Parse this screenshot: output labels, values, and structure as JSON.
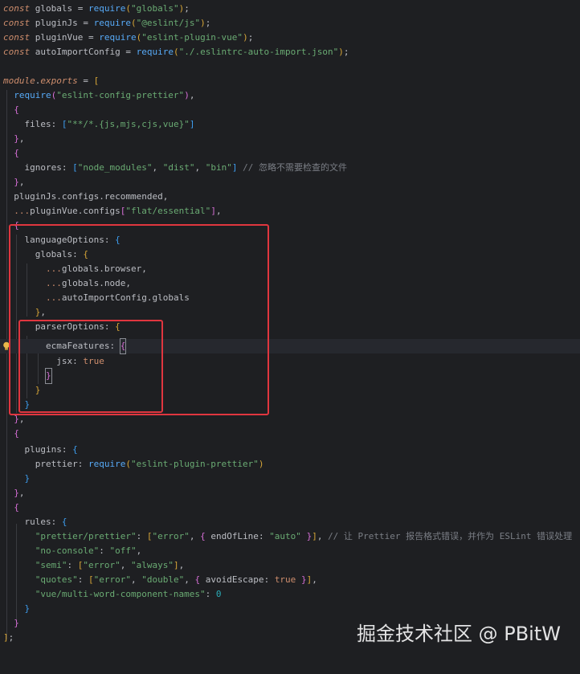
{
  "watermark": "掘金技术社区 @ PBitW",
  "tokens": {
    "const": "const",
    "globals": "globals",
    "pluginJs": "pluginJs",
    "pluginVue": "pluginVue",
    "autoImportConfig": "autoImportConfig",
    "require": "require",
    "s_globals": "\"globals\"",
    "s_eslint_js": "\"@eslint/js\"",
    "s_plugin_vue": "\"eslint-plugin-vue\"",
    "s_auto_import": "\"./.eslintrc-auto-import.json\"",
    "module": "module",
    "exports": "exports",
    "s_config_prettier": "\"eslint-config-prettier\"",
    "files": "files",
    "s_files_glob": "\"**/*.{js,mjs,cjs,vue}\"",
    "ignores": "ignores",
    "s_node_modules": "\"node_modules\"",
    "s_dist": "\"dist\"",
    "s_bin": "\"bin\"",
    "c_ignores": "// 忽略不需要检查的文件",
    "configs": "configs",
    "recommended": "recommended",
    "s_flat_essential": "\"flat/essential\"",
    "languageOptions": "languageOptions",
    "browser": "browser",
    "node": "node",
    "parserOptions": "parserOptions",
    "ecmaFeatures": "ecmaFeatures",
    "jsx": "jsx",
    "true": "true",
    "plugins": "plugins",
    "prettier": "prettier",
    "s_plugin_prettier": "\"eslint-plugin-prettier\"",
    "rules": "rules",
    "s_prettier_prettier": "\"prettier/prettier\"",
    "s_error": "\"error\"",
    "endOfLine": "endOfLine",
    "s_auto": "\"auto\"",
    "c_rules": "// 让 Prettier 报告格式错误，并作为 ESLint 错误处理",
    "s_no_console": "\"no-console\"",
    "s_off": "\"off\"",
    "s_semi": "\"semi\"",
    "s_always": "\"always\"",
    "s_quotes": "\"quotes\"",
    "s_double": "\"double\"",
    "avoidEscape": "avoidEscape",
    "s_multi_word": "\"vue/multi-word-component-names\"",
    "zero": "0",
    "spread": "...",
    "dot": ".",
    "eq": " = ",
    "colon": ": ",
    "comma": ",",
    "semi": ";"
  },
  "colors": {
    "background": "#1e1f22",
    "keyword": "#cf8e6d",
    "function": "#57aaf7",
    "string": "#6aab73",
    "comment": "#7a7e85",
    "number": "#2aacb8",
    "highlight_border": "#e0363f"
  }
}
